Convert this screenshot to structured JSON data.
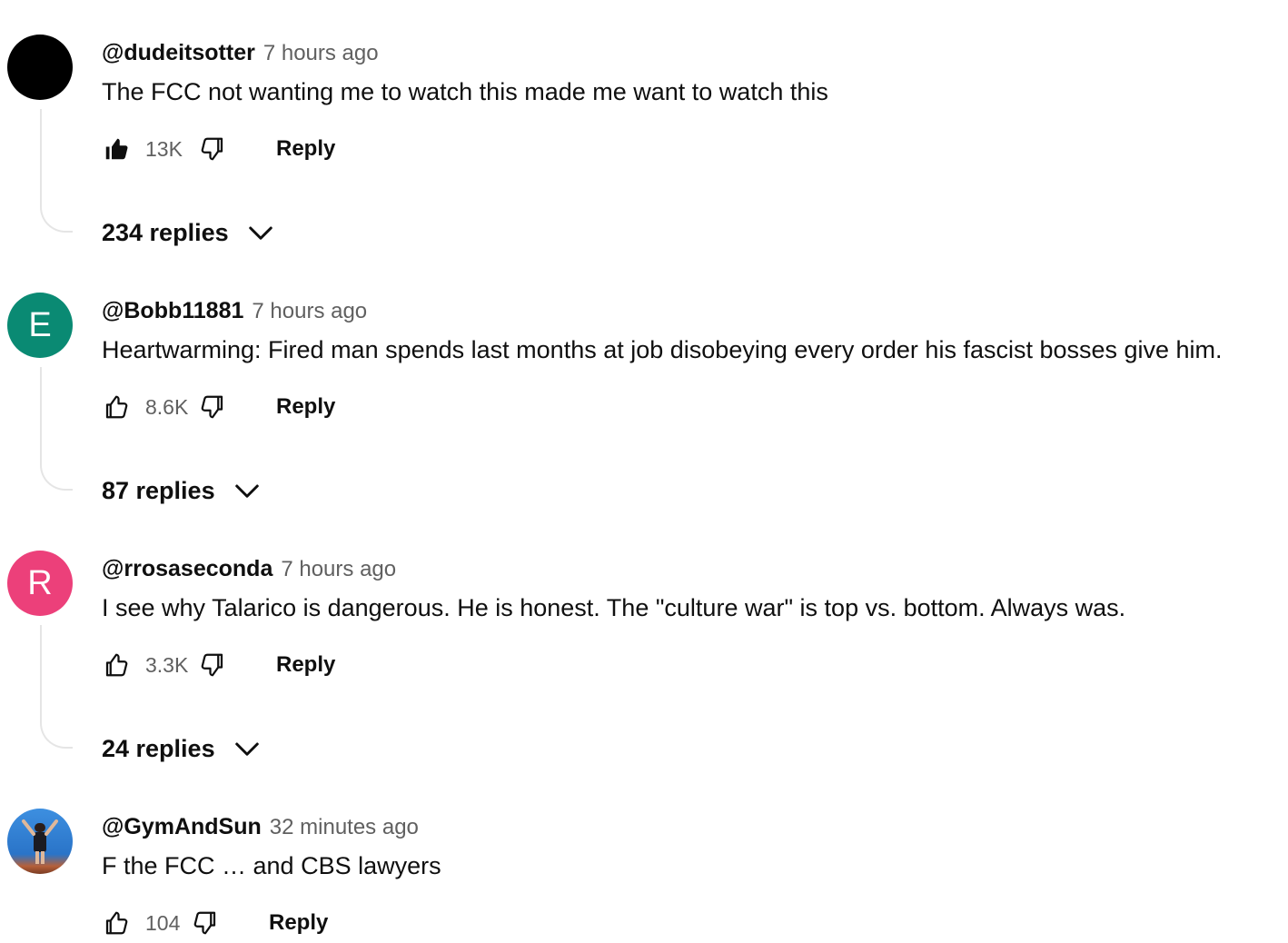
{
  "ui": {
    "reply_label": "Reply"
  },
  "comments": [
    {
      "avatar_letter": "",
      "avatar_color": "#000000",
      "handle": "@dudeitsotter",
      "time": "7 hours ago",
      "text": "The FCC not wanting me to watch this made me want to watch this",
      "likes": "13K",
      "liked": true,
      "replies": "234 replies"
    },
    {
      "avatar_letter": "E",
      "avatar_color": "#0a8a73",
      "handle": "@Bobb11881",
      "time": "7 hours ago",
      "text": "Heartwarming: Fired man spends last months at job disobeying every order his fascist bosses give him.",
      "likes": "8.6K",
      "liked": false,
      "replies": "87 replies"
    },
    {
      "avatar_letter": "R",
      "avatar_color": "#ec407a",
      "handle": "@rrosaseconda",
      "time": "7 hours ago",
      "text": "I see why Talarico is dangerous. He is honest. The \"culture war\" is top vs. bottom. Always was.",
      "likes": "3.3K",
      "liked": false,
      "replies": "24 replies"
    },
    {
      "avatar_letter": "",
      "avatar_color": "#2f7fd6",
      "handle": "@GymAndSun",
      "time": "32 minutes ago",
      "text": "F the FCC … and CBS lawyers",
      "likes": "104",
      "liked": false,
      "replies": ""
    }
  ]
}
